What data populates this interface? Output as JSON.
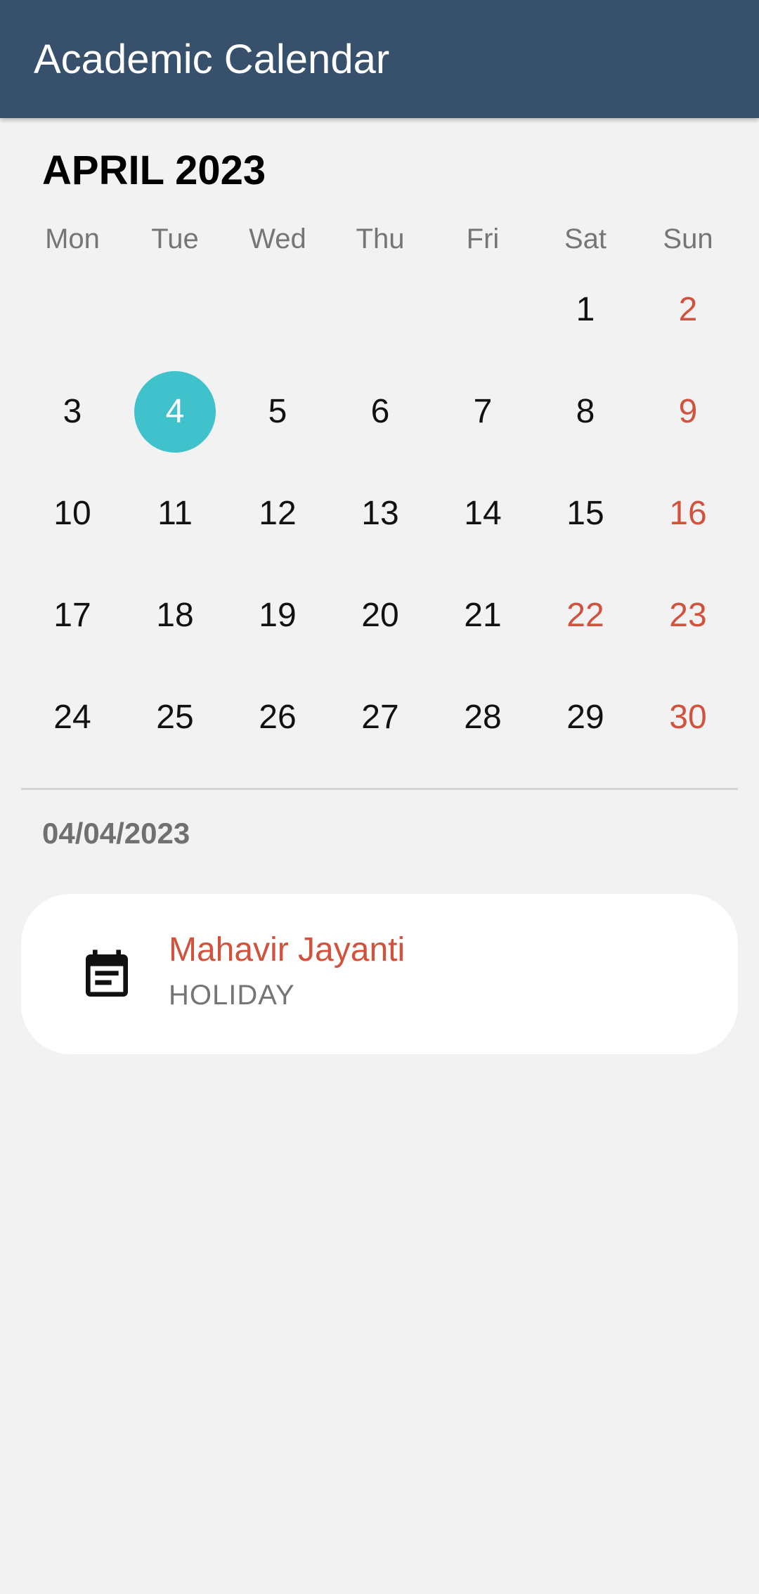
{
  "header": {
    "title": "Academic Calendar"
  },
  "calendar": {
    "month_label": "APRIL 2023",
    "weekdays": [
      "Mon",
      "Tue",
      "Wed",
      "Thu",
      "Fri",
      "Sat",
      "Sun"
    ],
    "days": [
      {
        "label": "",
        "holiday": false,
        "selected": false
      },
      {
        "label": "",
        "holiday": false,
        "selected": false
      },
      {
        "label": "",
        "holiday": false,
        "selected": false
      },
      {
        "label": "",
        "holiday": false,
        "selected": false
      },
      {
        "label": "",
        "holiday": false,
        "selected": false
      },
      {
        "label": "1",
        "holiday": false,
        "selected": false
      },
      {
        "label": "2",
        "holiday": true,
        "selected": false
      },
      {
        "label": "3",
        "holiday": false,
        "selected": false
      },
      {
        "label": "4",
        "holiday": false,
        "selected": true
      },
      {
        "label": "5",
        "holiday": false,
        "selected": false
      },
      {
        "label": "6",
        "holiday": false,
        "selected": false
      },
      {
        "label": "7",
        "holiday": false,
        "selected": false
      },
      {
        "label": "8",
        "holiday": false,
        "selected": false
      },
      {
        "label": "9",
        "holiday": true,
        "selected": false
      },
      {
        "label": "10",
        "holiday": false,
        "selected": false
      },
      {
        "label": "11",
        "holiday": false,
        "selected": false
      },
      {
        "label": "12",
        "holiday": false,
        "selected": false
      },
      {
        "label": "13",
        "holiday": false,
        "selected": false
      },
      {
        "label": "14",
        "holiday": false,
        "selected": false
      },
      {
        "label": "15",
        "holiday": false,
        "selected": false
      },
      {
        "label": "16",
        "holiday": true,
        "selected": false
      },
      {
        "label": "17",
        "holiday": false,
        "selected": false
      },
      {
        "label": "18",
        "holiday": false,
        "selected": false
      },
      {
        "label": "19",
        "holiday": false,
        "selected": false
      },
      {
        "label": "20",
        "holiday": false,
        "selected": false
      },
      {
        "label": "21",
        "holiday": false,
        "selected": false
      },
      {
        "label": "22",
        "holiday": true,
        "selected": false
      },
      {
        "label": "23",
        "holiday": true,
        "selected": false
      },
      {
        "label": "24",
        "holiday": false,
        "selected": false
      },
      {
        "label": "25",
        "holiday": false,
        "selected": false
      },
      {
        "label": "26",
        "holiday": false,
        "selected": false
      },
      {
        "label": "27",
        "holiday": false,
        "selected": false
      },
      {
        "label": "28",
        "holiday": false,
        "selected": false
      },
      {
        "label": "29",
        "holiday": false,
        "selected": false
      },
      {
        "label": "30",
        "holiday": true,
        "selected": false
      }
    ]
  },
  "selected_date": "04/04/2023",
  "events": [
    {
      "title": "Mahavir Jayanti",
      "type": "HOLIDAY",
      "icon": "event-note-icon"
    }
  ],
  "colors": {
    "header_bg": "#37506b",
    "selected_day": "#40c2cc",
    "holiday_text": "#d1523d",
    "page_bg": "#f2f2f2"
  }
}
